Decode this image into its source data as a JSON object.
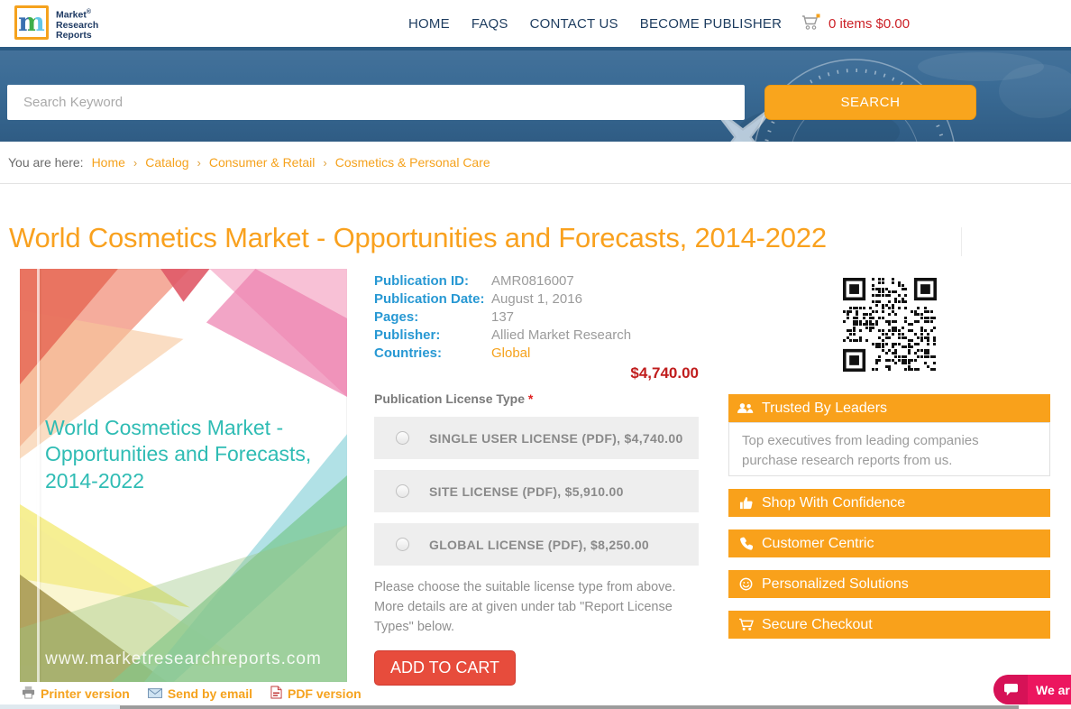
{
  "header": {
    "logo": {
      "mark": "m",
      "line1": "Market",
      "reg": "®",
      "line2": "Research",
      "line3": "Reports"
    },
    "nav": [
      {
        "label": "HOME"
      },
      {
        "label": "FAQS"
      },
      {
        "label": "CONTACT US"
      },
      {
        "label": "BECOME PUBLISHER"
      }
    ],
    "cart": {
      "text": "0 items $0.00"
    }
  },
  "search": {
    "placeholder": "Search Keyword",
    "button": "SEARCH"
  },
  "breadcrumb": {
    "prefix": "You are here:",
    "separator": "›",
    "items": [
      "Home",
      "Catalog",
      "Consumer & Retail",
      "Cosmetics & Personal Care"
    ]
  },
  "page": {
    "title": "World Cosmetics Market - Opportunities and Forecasts, 2014-2022"
  },
  "cover": {
    "title": "World Cosmetics Market - Opportunities and Forecasts, 2014-2022",
    "site": "www.marketresearchreports.com"
  },
  "version_links": [
    {
      "label": "Printer version"
    },
    {
      "label": "Send by email"
    },
    {
      "label": "PDF version"
    }
  ],
  "details": {
    "rows": [
      {
        "label": "Publication ID:",
        "value": "AMR0816007"
      },
      {
        "label": "Publication Date:",
        "value": "August 1, 2016"
      },
      {
        "label": "Pages:",
        "value": "137"
      },
      {
        "label": "Publisher:",
        "value": "Allied Market Research"
      },
      {
        "label": "Countries:",
        "value": "Global"
      }
    ],
    "price": "$4,740.00"
  },
  "license": {
    "label": "Publication License Type",
    "required_mark": "*",
    "options": [
      "SINGLE USER LICENSE (PDF), $4,740.00",
      "SITE LICENSE (PDF), $5,910.00",
      "GLOBAL LICENSE (PDF), $8,250.00"
    ],
    "note": "Please choose the suitable license type from above. More details are at given under tab \"Report License Types\" below.",
    "add_to_cart": "ADD TO CART"
  },
  "sidebar": {
    "banners": [
      {
        "label": "Trusted By Leaders",
        "icon": "users-icon",
        "description": "Top executives from leading companies purchase research reports from us."
      },
      {
        "label": "Shop With Confidence",
        "icon": "thumbs-up-icon"
      },
      {
        "label": "Customer Centric",
        "icon": "phone-icon"
      },
      {
        "label": "Personalized Solutions",
        "icon": "smiley-icon"
      },
      {
        "label": "Secure Checkout",
        "icon": "cart-icon"
      }
    ]
  },
  "chat": {
    "label": "We ar"
  },
  "colors": {
    "accent_orange": "#f5a21d",
    "sidebar_orange": "#f9a11b",
    "nav_navy": "#1d3c5f",
    "label_blue": "#2798d3",
    "price_red": "#c01d1d",
    "cart_red": "#cc2127",
    "add_to_cart_red": "#e74c3c",
    "chat_pink": "#ec165f",
    "hero_blue": "#3a6b95",
    "cover_title_teal": "#2fbcb4"
  }
}
